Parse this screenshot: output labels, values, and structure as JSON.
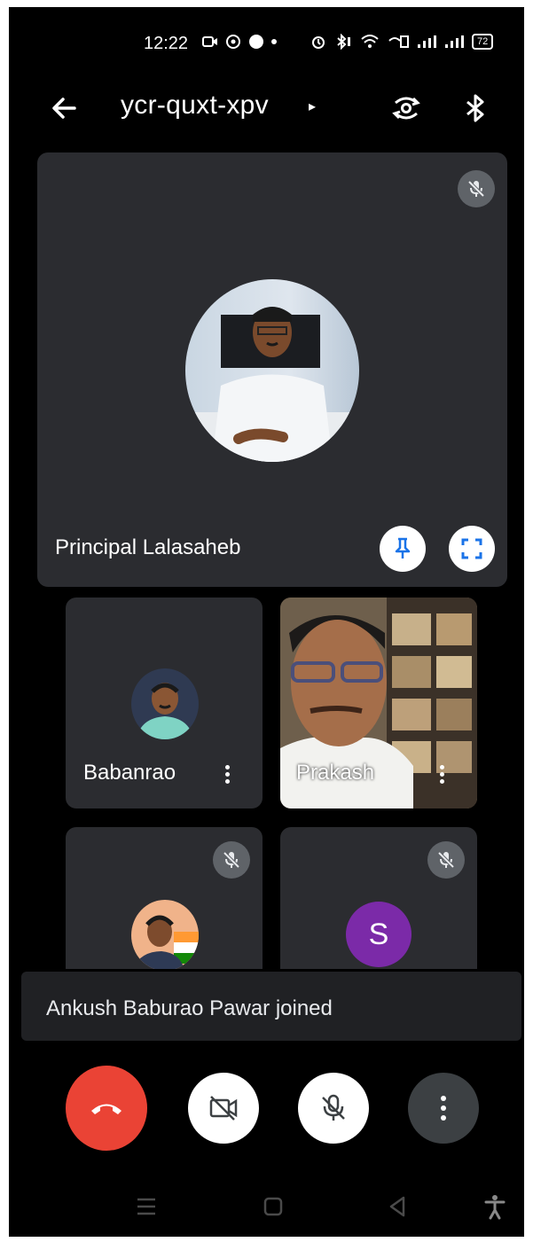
{
  "status_bar": {
    "time": "12:22",
    "battery": "72"
  },
  "header": {
    "meeting_code": "ycr-quxt-xpv",
    "caret": "▸"
  },
  "main_tile": {
    "name": "Principal Lalasaheb",
    "muted": true
  },
  "tiles": [
    {
      "name": "Babanrao",
      "muted": false
    },
    {
      "name": "Prakash",
      "muted": false
    },
    {
      "name": "",
      "muted": true
    },
    {
      "name": "",
      "initial": "S",
      "muted": true
    }
  ],
  "toast": {
    "message": "Ankush Baburao Pawar joined"
  },
  "colors": {
    "end_call": "#ea4335",
    "tile_bg": "#2b2c30",
    "initial_avatar": "#7b2aa8"
  }
}
